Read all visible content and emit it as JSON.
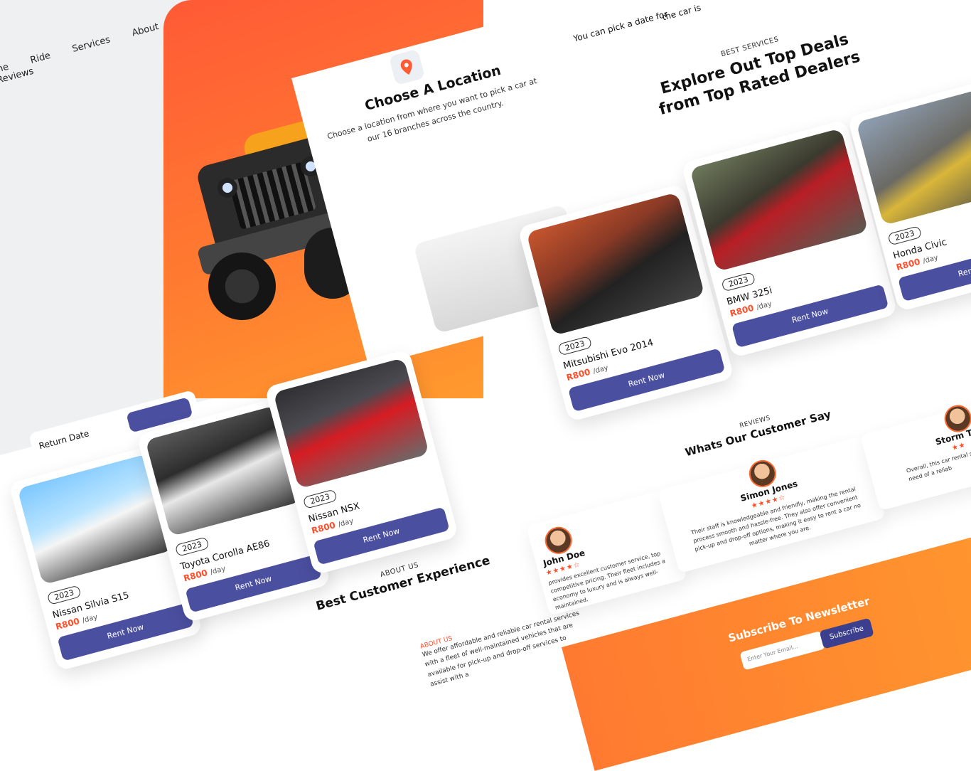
{
  "nav": {
    "items": [
      "me",
      "Ride",
      "Services",
      "About",
      "Reviews"
    ]
  },
  "location_step": {
    "title": "Choose A Location",
    "text": "Choose a location from where you want to pick a car at our 16 branches across the country."
  },
  "pickdate_snippet": {
    "text": "You can pick a date for",
    "text2": "the car is"
  },
  "deals": {
    "kicker": "BEST SERVICES",
    "title_line1": "Explore Out Top Deals",
    "title_line2": "from Top Rated Dealers",
    "cars": [
      {
        "year": "2023",
        "name": "Mitsubishi Evo 2014",
        "price": "R800",
        "unit": "/day",
        "cta": "Rent Now"
      },
      {
        "year": "2023",
        "name": "BMW 325i",
        "price": "R800",
        "unit": "/day",
        "cta": "Rent Now"
      },
      {
        "year": "2023",
        "name": "Honda Civic",
        "price": "R800",
        "unit": "/day",
        "cta": "Rent Now"
      }
    ]
  },
  "left_cars": [
    {
      "year": "2023",
      "name": "Nissan Silvia S15",
      "price": "R800",
      "unit": "/day",
      "cta": "Rent Now"
    },
    {
      "year": "2023",
      "name": "Toyota Corolla AE86",
      "price": "R800",
      "unit": "/day",
      "cta": "Rent Now"
    },
    {
      "year": "2023",
      "name": "Nissan NSX",
      "price": "R800",
      "unit": "/day",
      "cta": "Rent Now"
    }
  ],
  "booking": {
    "return_label": "Return Date"
  },
  "about": {
    "kicker": "ABOUT US",
    "title": "Best Customer Experience",
    "small_kicker": "ABOUT US",
    "text": "We offer affordable and reliable car rental services with a fleet of well-maintained vehicles that are available for pick-up and drop-off services to assist with a"
  },
  "reviews": {
    "kicker": "REVIEWS",
    "title": "Whats Our Customer Say",
    "items": [
      {
        "name": "John Doe",
        "stars": "★★★★☆",
        "text": "provides excellent customer service, top competitive pricing. Their fleet includes a economy to luxury and is always well-maintained."
      },
      {
        "name": "Simon Jones",
        "stars": "★★★★☆",
        "text": "Their staff is knowledgeable and friendly, making the rental process smooth and hassle-free. They also offer convenient pick-up and drop-off options, making it easy to rent a car no matter where you are."
      },
      {
        "name": "Storm Th",
        "stars": "★★",
        "text": "Overall, this car rental serv anyone in need of a reliab"
      }
    ]
  },
  "newsletter": {
    "title": "Subscribe To Newsletter",
    "placeholder": "Enter Your Email...",
    "button": "Subscribe"
  },
  "colors": {
    "accent": "#ff5a36",
    "button": "#4b4f9f",
    "background": "#eef0f2"
  }
}
